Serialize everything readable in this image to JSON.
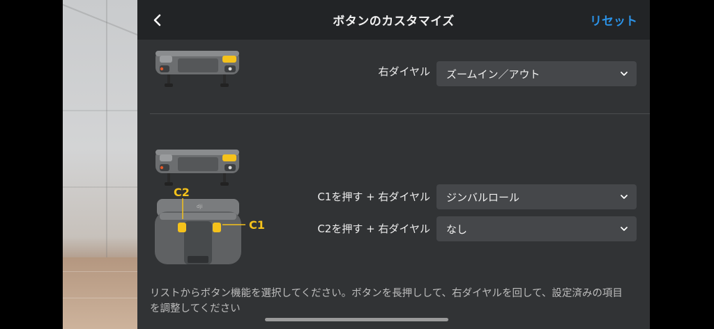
{
  "header": {
    "title": "ボタンのカスタマイズ",
    "reset_label": "リセット"
  },
  "rows": [
    {
      "label": "右ダイヤル",
      "value": "ズームイン／アウト"
    },
    {
      "label": "C1を押す + 右ダイヤル",
      "value": "ジンバルロール"
    },
    {
      "label": "C2を押す + 右ダイヤル",
      "value": "なし"
    }
  ],
  "diagram": {
    "c1_label": "C1",
    "c2_label": "C2"
  },
  "footer": {
    "instructions": "リストからボタン機能を選択してください。ボタンを長押しして、右ダイヤルを回して、設定済みの項目を調整してください"
  },
  "colors": {
    "accent": "#2b93e8",
    "highlight": "#f5c21b",
    "panel": "#313335",
    "header": "#222426",
    "select": "#45474a"
  }
}
